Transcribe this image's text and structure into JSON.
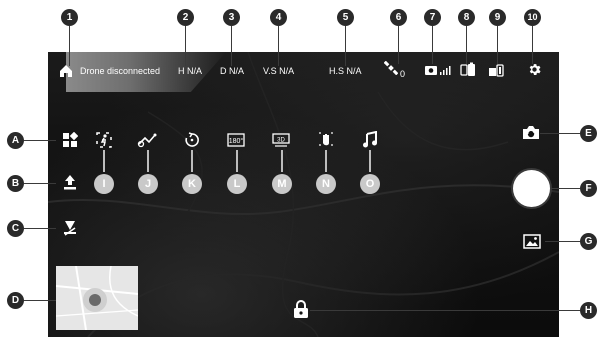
{
  "callouts_top": [
    "1",
    "2",
    "3",
    "4",
    "5",
    "6",
    "7",
    "8",
    "9",
    "10"
  ],
  "callouts_side": [
    "A",
    "B",
    "C",
    "D",
    "E",
    "F",
    "G",
    "H"
  ],
  "mode_labels": [
    "I",
    "J",
    "K",
    "L",
    "M",
    "N",
    "O"
  ],
  "status": {
    "connection": "Drone disconnected",
    "h": "H N/A",
    "d": "D N/A",
    "vs": "V.S N/A",
    "hs": "H.S N/A",
    "satellites": "0"
  },
  "icons": {
    "home": "home-icon",
    "gps": "satellite-icon",
    "camera_signal": "camera-signal-icon",
    "remote_battery": "remote-battery-icon",
    "drone_battery": "drone-battery-icon",
    "settings": "gear-icon",
    "menu": "grid-menu-icon",
    "takeoff": "takeoff-icon",
    "land": "land-icon",
    "map": "minimap",
    "switch_camera": "switch-camera-icon",
    "shutter": "shutter-button",
    "gallery": "gallery-icon",
    "lock": "lock-icon",
    "modes": [
      "follow-me-icon",
      "waypoint-icon",
      "orbit-icon",
      "panorama-180-icon",
      "vr-3d-icon",
      "gesture-icon",
      "music-icon"
    ]
  },
  "colors": {
    "screen_bg": "#111111",
    "callout_bg": "#2a2a2a",
    "mode_label_bg": "#c9c9c9"
  }
}
